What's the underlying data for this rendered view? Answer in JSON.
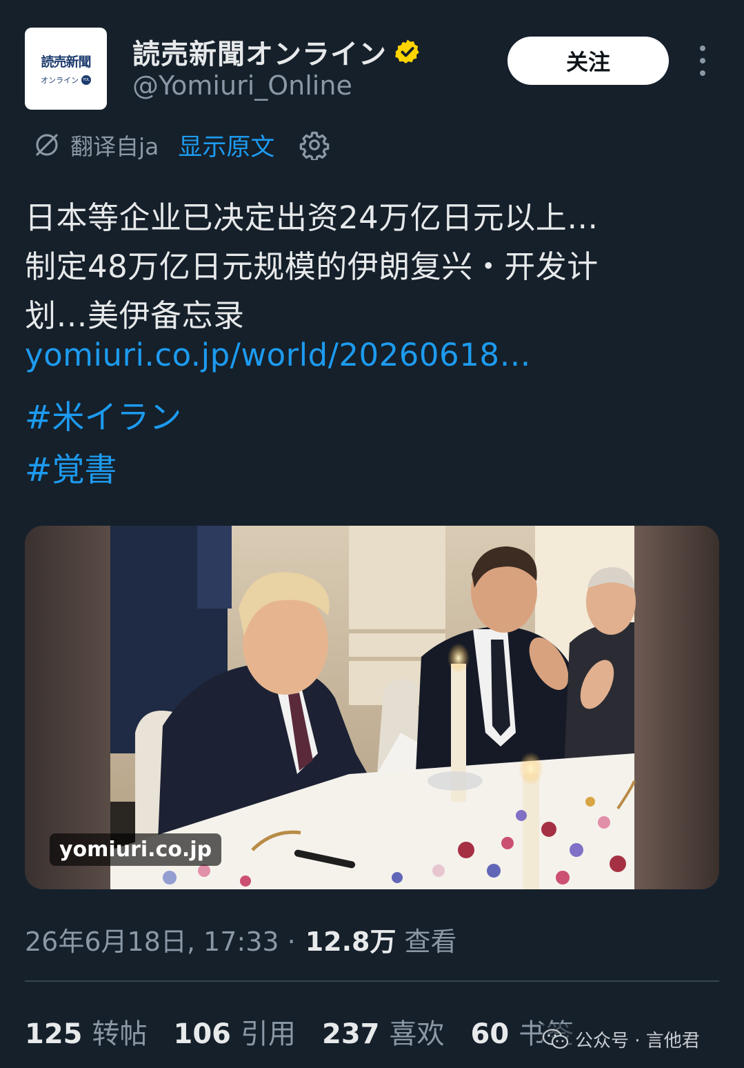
{
  "header": {
    "avatar": {
      "title": "読売新聞",
      "subtitle": "オンライン",
      "badge": "YOL"
    },
    "display_name": "読売新聞オンライン",
    "verified_icon": "verified-badge-icon",
    "handle": "@Yomiuri_Online",
    "follow_label": "关注",
    "more_icon": "more-vertical-icon"
  },
  "translation": {
    "icon": "translate-icon",
    "label": "翻译自ja",
    "show_original": "显示原文",
    "settings_icon": "gear-icon"
  },
  "tweet": {
    "lines": [
      "日本等企业已决定出资24万亿日元以上…",
      "制定48万亿日元规模的伊朗复兴・开发计",
      "划…美伊备忘录"
    ],
    "link": "yomiuri.co.jp/world/20260618…",
    "hashtags": [
      "#米イラン",
      "#覚書"
    ]
  },
  "media": {
    "source_label": "yomiuri.co.jp"
  },
  "meta": {
    "timestamp": "26年6月18日, 17:33 ·",
    "views": "12.8万",
    "views_label": "查看"
  },
  "stats": {
    "retweets": {
      "value": "125",
      "label": "转帖"
    },
    "quotes": {
      "value": "106",
      "label": "引用"
    },
    "likes": {
      "value": "237",
      "label": "喜欢"
    },
    "bookmarks": {
      "value": "60",
      "label": "书签"
    }
  },
  "watermark": {
    "icon": "wechat-icon",
    "text": "公众号 · 言他君"
  },
  "colors": {
    "background": "#15202b",
    "accent": "#1d9bf0",
    "muted": "#8b98a5",
    "verified": "#ffd400"
  }
}
